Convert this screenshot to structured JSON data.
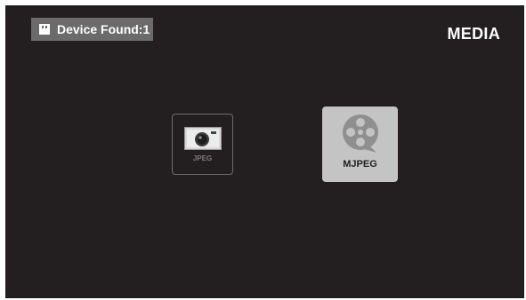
{
  "header": {
    "device_status": "Device Found:1",
    "title": "MEDIA",
    "status_icon": "usb-drive-icon"
  },
  "media_tiles": [
    {
      "label": "JPEG",
      "icon": "camera-icon",
      "selected": false
    },
    {
      "label": "MJPEG",
      "icon": "film-reel-icon",
      "selected": true
    }
  ],
  "colors": {
    "screen_background": "#231f20",
    "badge_background": "#6b6b6b",
    "selected_tile": "#c4c4c4",
    "unselected_tile_border": "#6d6d6d"
  }
}
